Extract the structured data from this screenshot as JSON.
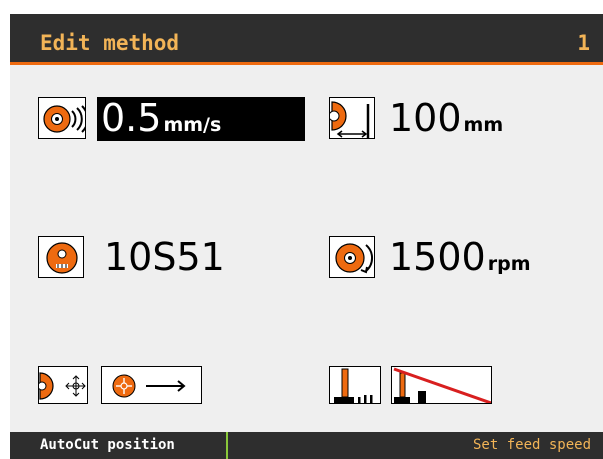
{
  "header": {
    "title": "Edit method",
    "number": "1"
  },
  "params": {
    "feed_speed": {
      "value": "0.5",
      "unit": "mm/s",
      "icon": "feed-speed-icon"
    },
    "cut_length": {
      "value": "100",
      "unit": "mm",
      "icon": "cut-length-icon"
    },
    "wheel": {
      "value": "10S51",
      "icon": "wheel-type-icon"
    },
    "wheel_speed": {
      "value": "1500",
      "unit": "rpm",
      "icon": "wheel-speed-icon"
    },
    "autocut_position": {
      "icon": "autocut-position-icon",
      "value_icon": "position-arrow-icon"
    },
    "force_setting": {
      "icon": "force-icon",
      "value_icon": "force-disabled-icon"
    }
  },
  "footer": {
    "left_softkey": "AutoCut position",
    "right_softkey": "Set feed speed"
  },
  "colors": {
    "accent": "#ee6a10",
    "header_text": "#f2b457",
    "softkey_divider": "#8ac83a"
  }
}
